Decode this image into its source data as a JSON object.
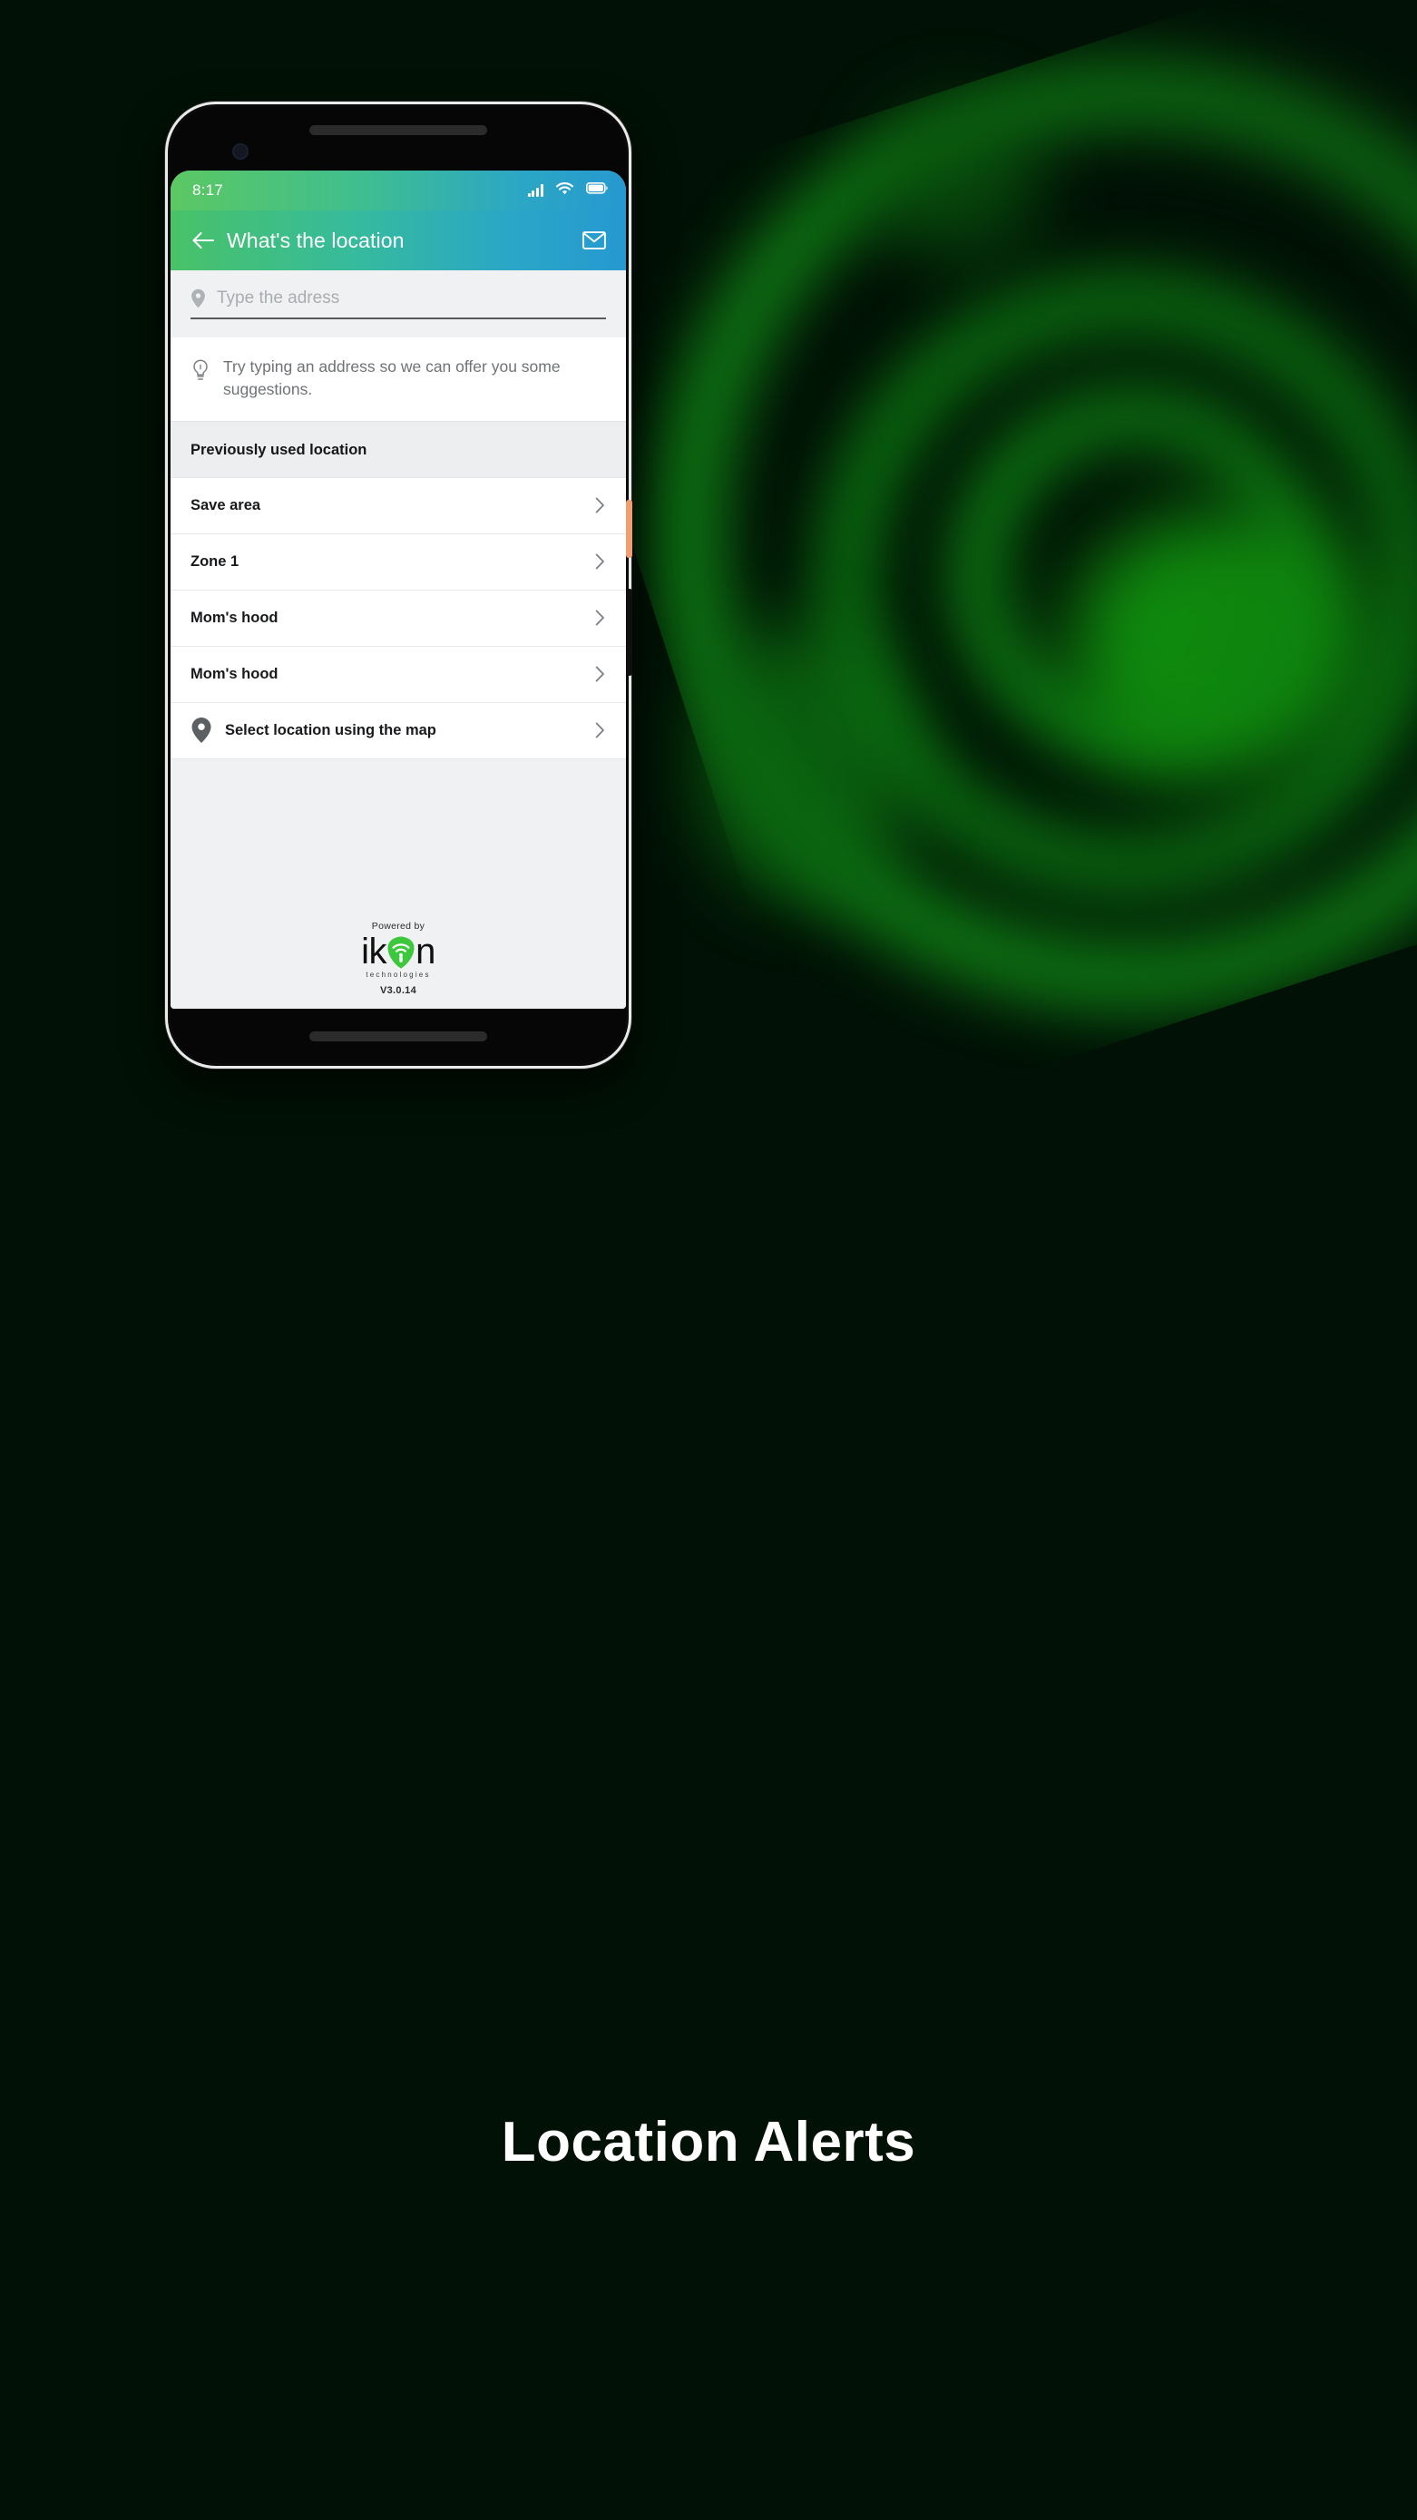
{
  "background": {
    "color": "#011105",
    "accent_green": "#14a01a"
  },
  "caption": {
    "text": "Location Alerts"
  },
  "phone": {
    "status_bar": {
      "time": "8:17",
      "icons": [
        "signal-bars-icon",
        "wifi-icon",
        "battery-icon"
      ]
    },
    "app_bar": {
      "back_label": "←",
      "title": "What's the location",
      "mail_icon": "mail-icon"
    },
    "search": {
      "placeholder": "Type the adress",
      "value": "",
      "icon": "location-pin-icon"
    },
    "hint": {
      "icon": "lightbulb-icon",
      "text": "Try typing an address so we can offer you some suggestions."
    },
    "section": {
      "header": "Previously used location"
    },
    "locations": [
      {
        "label": "Save area",
        "icon": null,
        "chevron": "chevron-right-icon"
      },
      {
        "label": "Zone 1",
        "icon": null,
        "chevron": "chevron-right-icon"
      },
      {
        "label": "Mom's hood",
        "icon": null,
        "chevron": "chevron-right-icon"
      },
      {
        "label": "Mom's hood",
        "icon": null,
        "chevron": "chevron-right-icon"
      }
    ],
    "map_row": {
      "label": "Select location using the map",
      "icon": "location-pin-icon",
      "chevron": "chevron-right-icon"
    },
    "footer": {
      "powered_by": "Powered by",
      "brand_part1": "ik",
      "brand_part2": "n",
      "brand_sub": "technologies",
      "version": "V3.0.14",
      "logo_color": "#3cc73c"
    },
    "hardware": {
      "power_button_color": "#f0a070"
    }
  },
  "theme": {
    "header_gradient_start": "#5cc863",
    "header_gradient_end": "#2699d0",
    "screen_bg": "#f0f1f2",
    "card_bg": "#ffffff"
  }
}
